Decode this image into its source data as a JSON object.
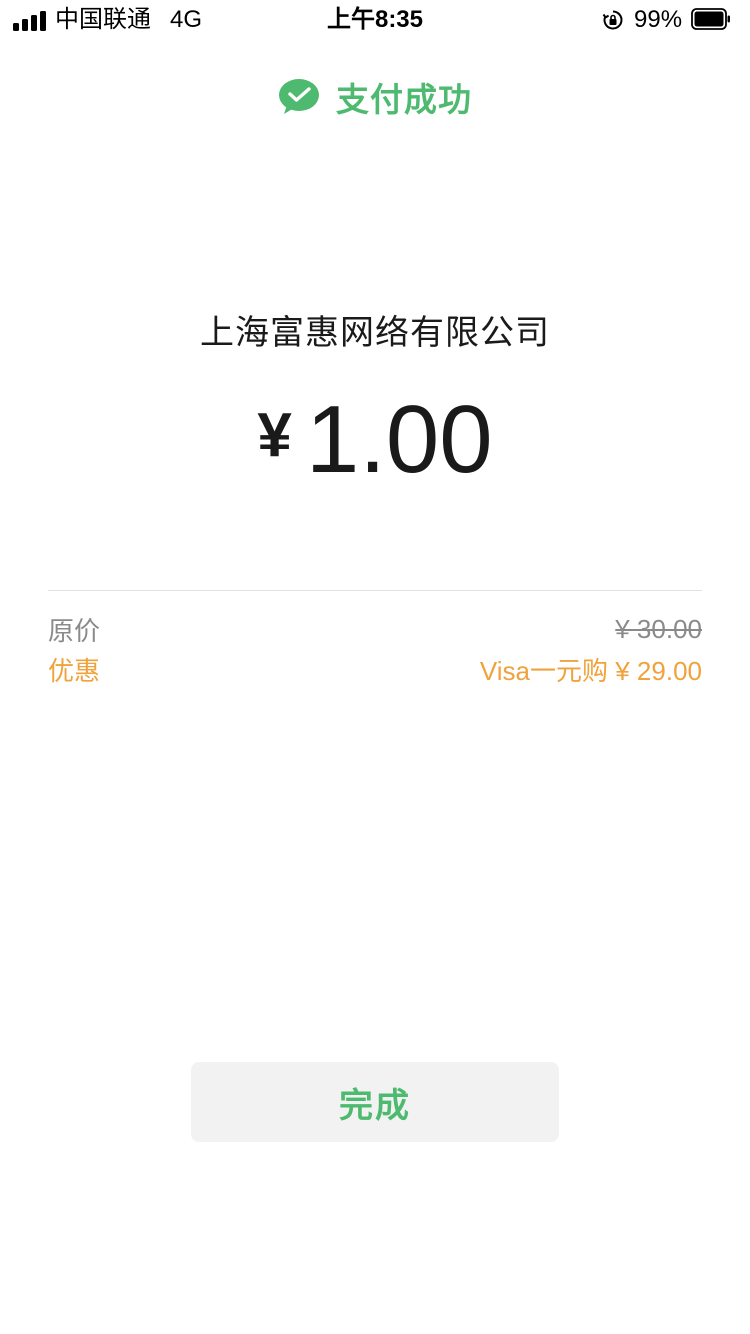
{
  "status_bar": {
    "carrier": "中国联通",
    "network": "4G",
    "time": "上午8:35",
    "battery_percent": "99%",
    "signal_bars": 4,
    "icons": [
      "signal-icon",
      "orientation-lock-icon",
      "battery-icon"
    ]
  },
  "header": {
    "title": "支付成功",
    "icon": "wechat-pay-icon",
    "accent_color": "#4eba6f"
  },
  "payment": {
    "merchant": "上海富惠网络有限公司",
    "currency_symbol": "¥",
    "amount": "1.00"
  },
  "details": {
    "original_label": "原价",
    "original_value": "¥ 30.00",
    "discount_label": "优惠",
    "discount_value": "Visa一元购 ¥ 29.00",
    "discount_color": "#f0a23c"
  },
  "actions": {
    "done_label": "完成"
  }
}
